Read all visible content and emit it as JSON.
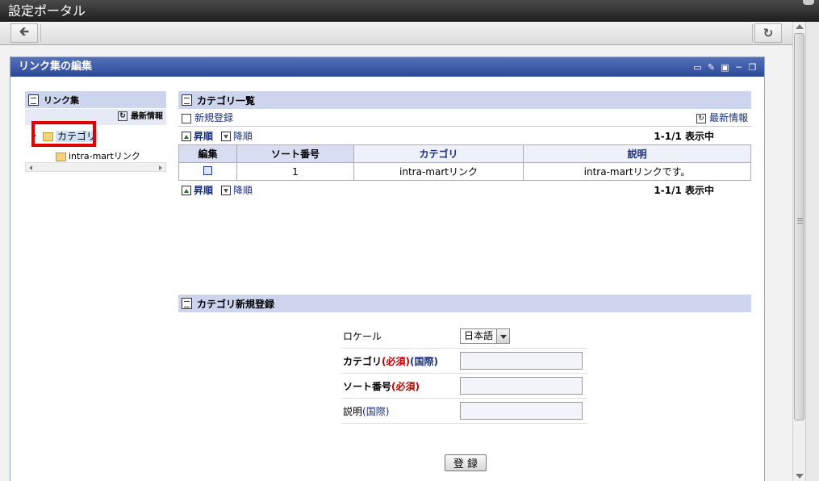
{
  "window": {
    "title": "設定ポータル"
  },
  "portlet": {
    "title": "リンク集の編集"
  },
  "left": {
    "header": "リンク集",
    "refresh_label": "最新情報",
    "tree_root": "カテゴリ",
    "tree_child": "intra-martリンク"
  },
  "list": {
    "header": "カテゴリ一覧",
    "new_label": "新規登録",
    "refresh_label": "最新情報",
    "asc_label": "昇順",
    "desc_label": "降順",
    "count_label": "1-1/1  表示中",
    "columns": [
      "編集",
      "ソート番号",
      "カテゴリ",
      "説明"
    ],
    "rows": [
      {
        "sort": "1",
        "category": "intra-martリンク",
        "description": "intra-martリンクです。"
      }
    ]
  },
  "newform": {
    "header": "カテゴリ新規登録",
    "locale_label": "ロケール",
    "locale_value": "日本語",
    "category_label": "カテゴリ",
    "sort_label": "ソート番号",
    "desc_label": "説明",
    "required": "(必須)",
    "intl": "(国際)",
    "submit": "登 録"
  }
}
